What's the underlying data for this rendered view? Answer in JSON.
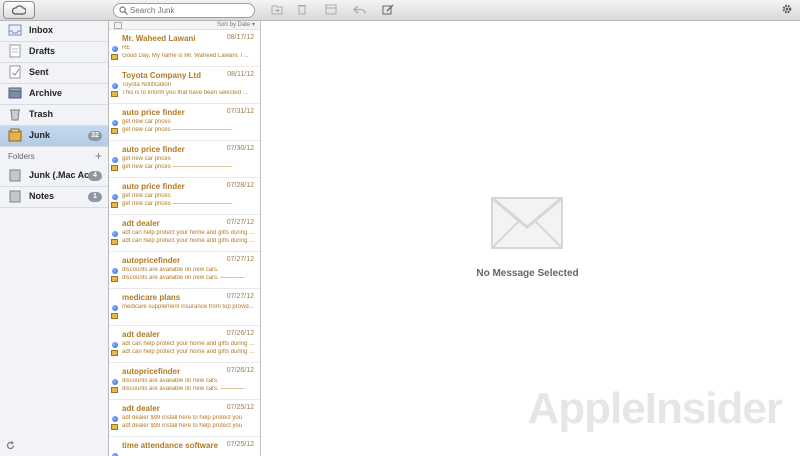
{
  "search": {
    "placeholder": "Search Junk"
  },
  "sidebar": {
    "mailboxes": [
      {
        "label": "Inbox"
      },
      {
        "label": "Drafts"
      },
      {
        "label": "Sent"
      },
      {
        "label": "Archive"
      },
      {
        "label": "Trash"
      },
      {
        "label": "Junk",
        "count": "32"
      }
    ],
    "folders_label": "Folders",
    "folders": [
      {
        "label": "Junk (.Mac Ac...",
        "count": "4"
      },
      {
        "label": "Notes",
        "count": "1"
      }
    ]
  },
  "list": {
    "sort_label": "Sort by Date",
    "messages": [
      {
        "from": "Mr. Waheed Lawani",
        "date": "08/17/12",
        "line1": "RE",
        "line2": "Good Day, My name is Mr. Waheed Lawani. I ..."
      },
      {
        "from": "Toyota Company Ltd",
        "date": "08/11/12",
        "line1": "Toyota Notification",
        "line2": "This is to inform you that have been selected ..."
      },
      {
        "from": "auto price finder",
        "date": "07/31/12",
        "line1": "get new car prices",
        "line2": "get new car prices ——————————"
      },
      {
        "from": "auto price finder",
        "date": "07/30/12",
        "line1": "get new car prices",
        "line2": "get new car prices ——————————"
      },
      {
        "from": "auto price finder",
        "date": "07/28/12",
        "line1": "get new car prices",
        "line2": "get new car prices ——————————"
      },
      {
        "from": "adt dealer",
        "date": "07/27/12",
        "line1": "adt can help protect your home and gifts during ...",
        "line2": "adt can help protect your home and gifts during ..."
      },
      {
        "from": "autopricefinder",
        "date": "07/27/12",
        "line1": "discounts are available on new cars.",
        "line2": "discounts are available on new cars. ————"
      },
      {
        "from": "medicare plans",
        "date": "07/27/12",
        "line1": "medicare supplement insurance from top provid...",
        "line2": ""
      },
      {
        "from": "adt dealer",
        "date": "07/26/12",
        "line1": "adt can help protect your home and gifts during ...",
        "line2": "adt can help protect your home and gifts during ..."
      },
      {
        "from": "autopricefinder",
        "date": "07/26/12",
        "line1": "discounts are available on new cars.",
        "line2": "discounts are available on new cars. ————"
      },
      {
        "from": "adt dealer",
        "date": "07/25/12",
        "line1": "adt dealer $99 install here to help protect you",
        "line2": "adt dealer $99 install here to help protect you"
      },
      {
        "from": "time attendance software",
        "date": "07/25/12",
        "line1": "",
        "line2": ""
      }
    ]
  },
  "detail": {
    "empty_text": "No Message Selected"
  },
  "watermark": "AppleInsider",
  "colors": {
    "accent_from": "#b27a24",
    "selected_bg": "#b3cbe6",
    "badge": "#8f97a3"
  }
}
